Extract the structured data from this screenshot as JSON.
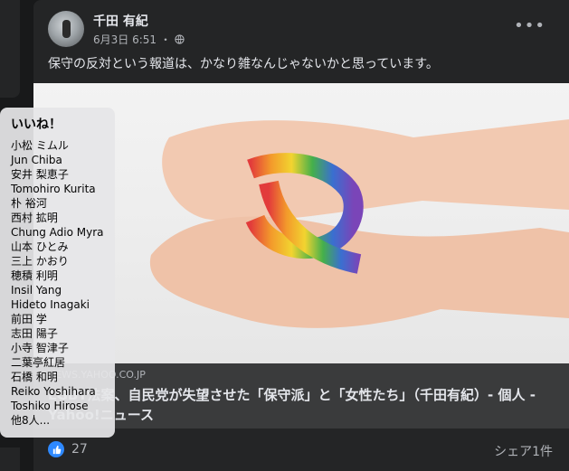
{
  "post": {
    "author": "千田 有紀",
    "date": "6月3日 6:51",
    "separator": "・",
    "text": "保守の反対という報道は、かなり雑なんじゃないかと思っています。",
    "more": "•••",
    "privacy_icon": "globe-icon"
  },
  "link": {
    "domain": "NEWS.YAHOO.CO.JP",
    "title": "LGBT法案、自民党が失望させた「保守派」と「女性たち」（千田有紀）- 個人 - Yahoo!ニュース"
  },
  "footer": {
    "like_count": "27",
    "shares": "シェア1件",
    "like_icon": "thumbs-up-icon"
  },
  "likes_tooltip": {
    "title": "いいね！",
    "names": [
      "小松 ミムル",
      "Jun Chiba",
      "安井 梨恵子",
      "Tomohiro Kurita",
      "朴 裕河",
      "西村 拡明",
      "Chung Adio Myra",
      "山本 ひとみ",
      "三上 かおり",
      "穂積 利明",
      "Insil Yang",
      "Hideto Inagaki",
      "前田 学",
      "志田 陽子",
      "小寺 智津子",
      "二葉亭紅居",
      "石橋 和明",
      "Reiko Yoshihara",
      "Toshiko Hirose",
      "他8人..."
    ]
  },
  "colors": {
    "background": "#18191a",
    "card": "#242526",
    "link_box": "#3a3b3c",
    "text_primary": "#e4e6eb",
    "text_secondary": "#b0b3b8",
    "like_blue": "#2e89ff"
  }
}
